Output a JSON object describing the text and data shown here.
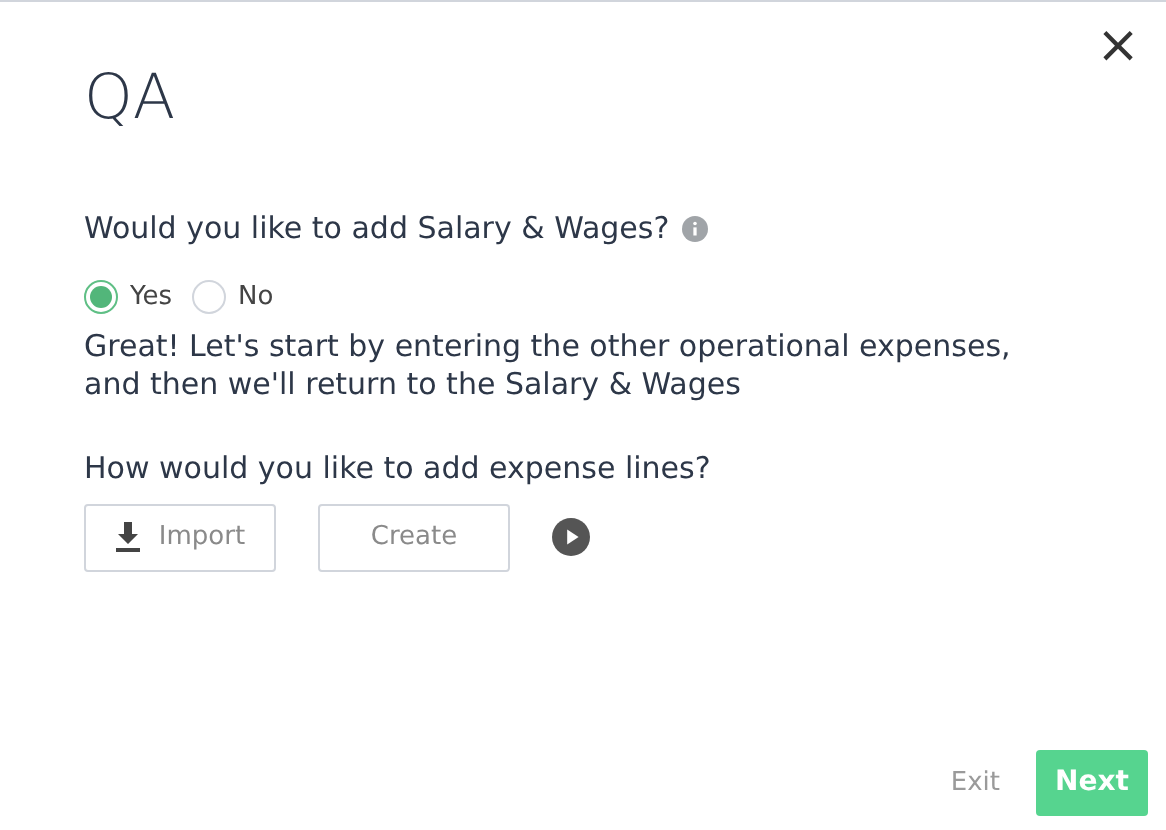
{
  "dialog": {
    "title": "QA",
    "close": "×"
  },
  "question": {
    "text": "Would you like to add Salary & Wages?"
  },
  "options": [
    {
      "label": "Yes",
      "selected": true
    },
    {
      "label": "No",
      "selected": false
    }
  ],
  "message": "Great! Let's start by entering the other operational expenses, and then we'll return to the Salary & Wages",
  "expense_question": "How would you like to add expense lines?",
  "expense_buttons": [
    {
      "label": "Import",
      "kind": "import"
    },
    {
      "label": "Create",
      "kind": "plain"
    }
  ],
  "footer": {
    "exit": "Exit",
    "next": "Next"
  }
}
